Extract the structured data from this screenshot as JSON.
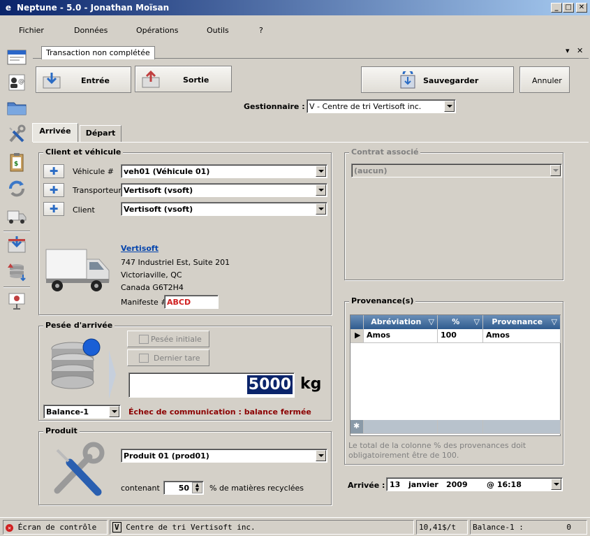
{
  "window": {
    "title": "Neptune - 5.0 - Jonathan Moïsan",
    "logo": "e"
  },
  "menu": [
    "Fichier",
    "Données",
    "Opérations",
    "Outils",
    "?"
  ],
  "sidebar_icons": [
    "window-icon",
    "contacts-icon",
    "folder-icon",
    "tools-icon",
    "clipboard-money-icon",
    "refresh-icon",
    "truck-icon",
    "inbox-arrow-icon",
    "scale-stack-icon",
    "presentation-icon"
  ],
  "document": {
    "tab_label": "Transaction non complétée",
    "pin": "▾",
    "close": "✕"
  },
  "toolbar": {
    "entree": "Entrée",
    "sortie": "Sortie",
    "sauvegarder": "Sauvegarder",
    "annuler": "Annuler"
  },
  "gestionnaire": {
    "label": "Gestionnaire :",
    "value": "V - Centre de tri Vertisoft inc."
  },
  "tabs": {
    "arrivee": "Arrivée",
    "depart": "Départ"
  },
  "client": {
    "title": "Client et véhicule",
    "vehicule_label": "Véhicule #",
    "vehicule_value": "veh01 (Véhicule 01)",
    "transporteur_label": "Transporteur",
    "transporteur_value": "Vertisoft (vsoft)",
    "client_label": "Client",
    "client_value": "Vertisoft (vsoft)",
    "company": "Vertisoft",
    "address1": "747 Industriel Est, Suite 201",
    "address2": "Victoriaville, QC",
    "address3": "Canada G6T2H4",
    "manifeste_label": "Manifeste #",
    "manifeste_value": "ABCD"
  },
  "contrat": {
    "title": "Contrat associé",
    "value": "(aucun)"
  },
  "pesee": {
    "title": "Pesée d'arrivée",
    "btn_initiale": "Pesée initiale",
    "btn_tare": "Dernier tare",
    "weight": "5000",
    "unit": "kg",
    "balance": "Balance-1",
    "error": "Échec de communication : balance fermée"
  },
  "provenances": {
    "title": "Provenance(s)",
    "columns": [
      "Abréviation",
      "%",
      "Provenance"
    ],
    "rows": [
      [
        "Amos",
        "100",
        "Amos"
      ]
    ],
    "new_row_marker": "✱",
    "note_line1": "Le total de la colonne % des provenances doit",
    "note_line2": "obligatoirement être de 100."
  },
  "produit": {
    "title": "Produit",
    "value": "Produit 01 (prod01)",
    "contenant": "contenant",
    "pct": "50",
    "suffix": "% de matières recyclées"
  },
  "arrivee_date": {
    "label": "Arrivée :",
    "day": "13",
    "month": "janvier",
    "year": "2009",
    "time": "@ 16:18"
  },
  "status": {
    "ecran": "Écran de contrôle",
    "centre_icon": "V",
    "centre": "Centre de tri Vertisoft inc.",
    "prix": "10,41$/t",
    "balance": "Balance-1 :",
    "balance_value": "0"
  },
  "colors": {
    "accent": "#0a246a",
    "grid_header": "#2f5b8e",
    "error": "#8b0000",
    "weight_bg": "#0a246a"
  }
}
